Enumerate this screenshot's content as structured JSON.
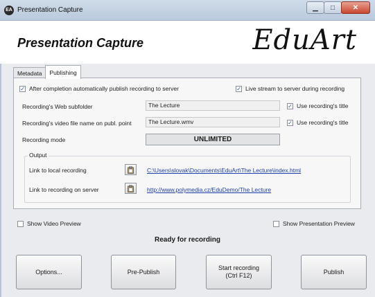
{
  "window": {
    "title": "Presentation Capture",
    "icon": "EA",
    "min_glyph": "▁",
    "max_glyph": "□",
    "close_glyph": "✕"
  },
  "header": {
    "heading": "Presentation Capture",
    "logo_text": "EduArt"
  },
  "tabs": [
    {
      "label": "Metadata"
    },
    {
      "label": "Publishing",
      "active": true
    }
  ],
  "publishing": {
    "auto_publish": {
      "label": "After completion automatically publish recording to server",
      "checked": true
    },
    "live_stream": {
      "label": "Live stream to server during recording",
      "checked": true
    },
    "web_subfolder": {
      "label": "Recording's Web subfolder",
      "value": "The Lecture"
    },
    "use_title_1": {
      "label": "Use recording's title",
      "checked": true
    },
    "video_file": {
      "label": "Recording's video file name on publ. point",
      "value": "The Lecture.wmv"
    },
    "use_title_2": {
      "label": "Use recording's title",
      "checked": true
    },
    "mode": {
      "label": "Recording mode",
      "value": "UNLIMITED"
    },
    "output": {
      "title": "Output",
      "local": {
        "label": "Link to local recording",
        "link": "C:\\Users\\slovak\\Documents\\EduArt\\The Lecture\\index.html"
      },
      "server": {
        "label": "Link to recording on server",
        "link": "http://www.polymedia.cz/EduDemo/The Lecture"
      }
    }
  },
  "preview": {
    "video": {
      "label": "Show Video Preview",
      "checked": false
    },
    "presentation": {
      "label": "Show Presentation Preview",
      "checked": false
    }
  },
  "status": "Ready for recording",
  "buttons": {
    "options": "Options...",
    "pre_publish": "Pre-Publish",
    "start_line1": "Start recording",
    "start_line2": "(Ctrl F12)",
    "publish": "Publish"
  },
  "check_glyph": "✓",
  "icons": {
    "copy": "clipboard-icon"
  }
}
